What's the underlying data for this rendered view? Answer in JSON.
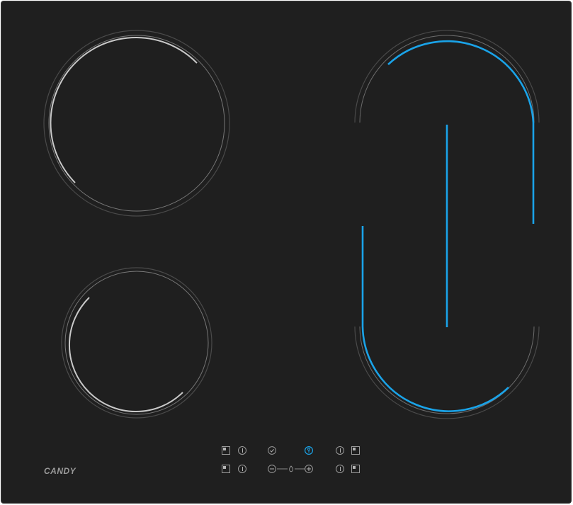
{
  "brand": {
    "logo_text": "CANDY"
  },
  "colors": {
    "glass": "#1f1f1f",
    "outline": "#9a9a9a",
    "active_blue": "#1aa3e8"
  },
  "zones": [
    {
      "name": "rear-left-zone",
      "state": "highlighted"
    },
    {
      "name": "front-left-zone",
      "state": "highlighted"
    },
    {
      "name": "right-oval-zone",
      "state": "active"
    }
  ],
  "controls": {
    "row1": [
      "zone-select-icon",
      "power-icon",
      "check-icon",
      "key-lock-icon",
      "power-icon",
      "zone-select-icon"
    ],
    "row2": [
      "zone-select-icon",
      "power-icon",
      "minus-icon",
      "flame-icon",
      "plus-icon",
      "power-icon",
      "zone-select-icon"
    ]
  }
}
